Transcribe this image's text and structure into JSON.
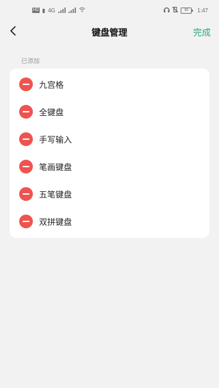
{
  "status_bar": {
    "hd_badge": "HD",
    "network": "4G",
    "time": "1:47",
    "battery": "66"
  },
  "header": {
    "title": "键盘管理",
    "done_label": "完成"
  },
  "section": {
    "added_label": "已添加"
  },
  "keyboards": [
    {
      "label": "九宫格"
    },
    {
      "label": "全键盘"
    },
    {
      "label": "手写输入"
    },
    {
      "label": "笔画键盘"
    },
    {
      "label": "五笔键盘"
    },
    {
      "label": "双拼键盘"
    }
  ],
  "colors": {
    "accent": "#2ea777",
    "remove": "#ef5350",
    "background": "#f2f2f2"
  }
}
